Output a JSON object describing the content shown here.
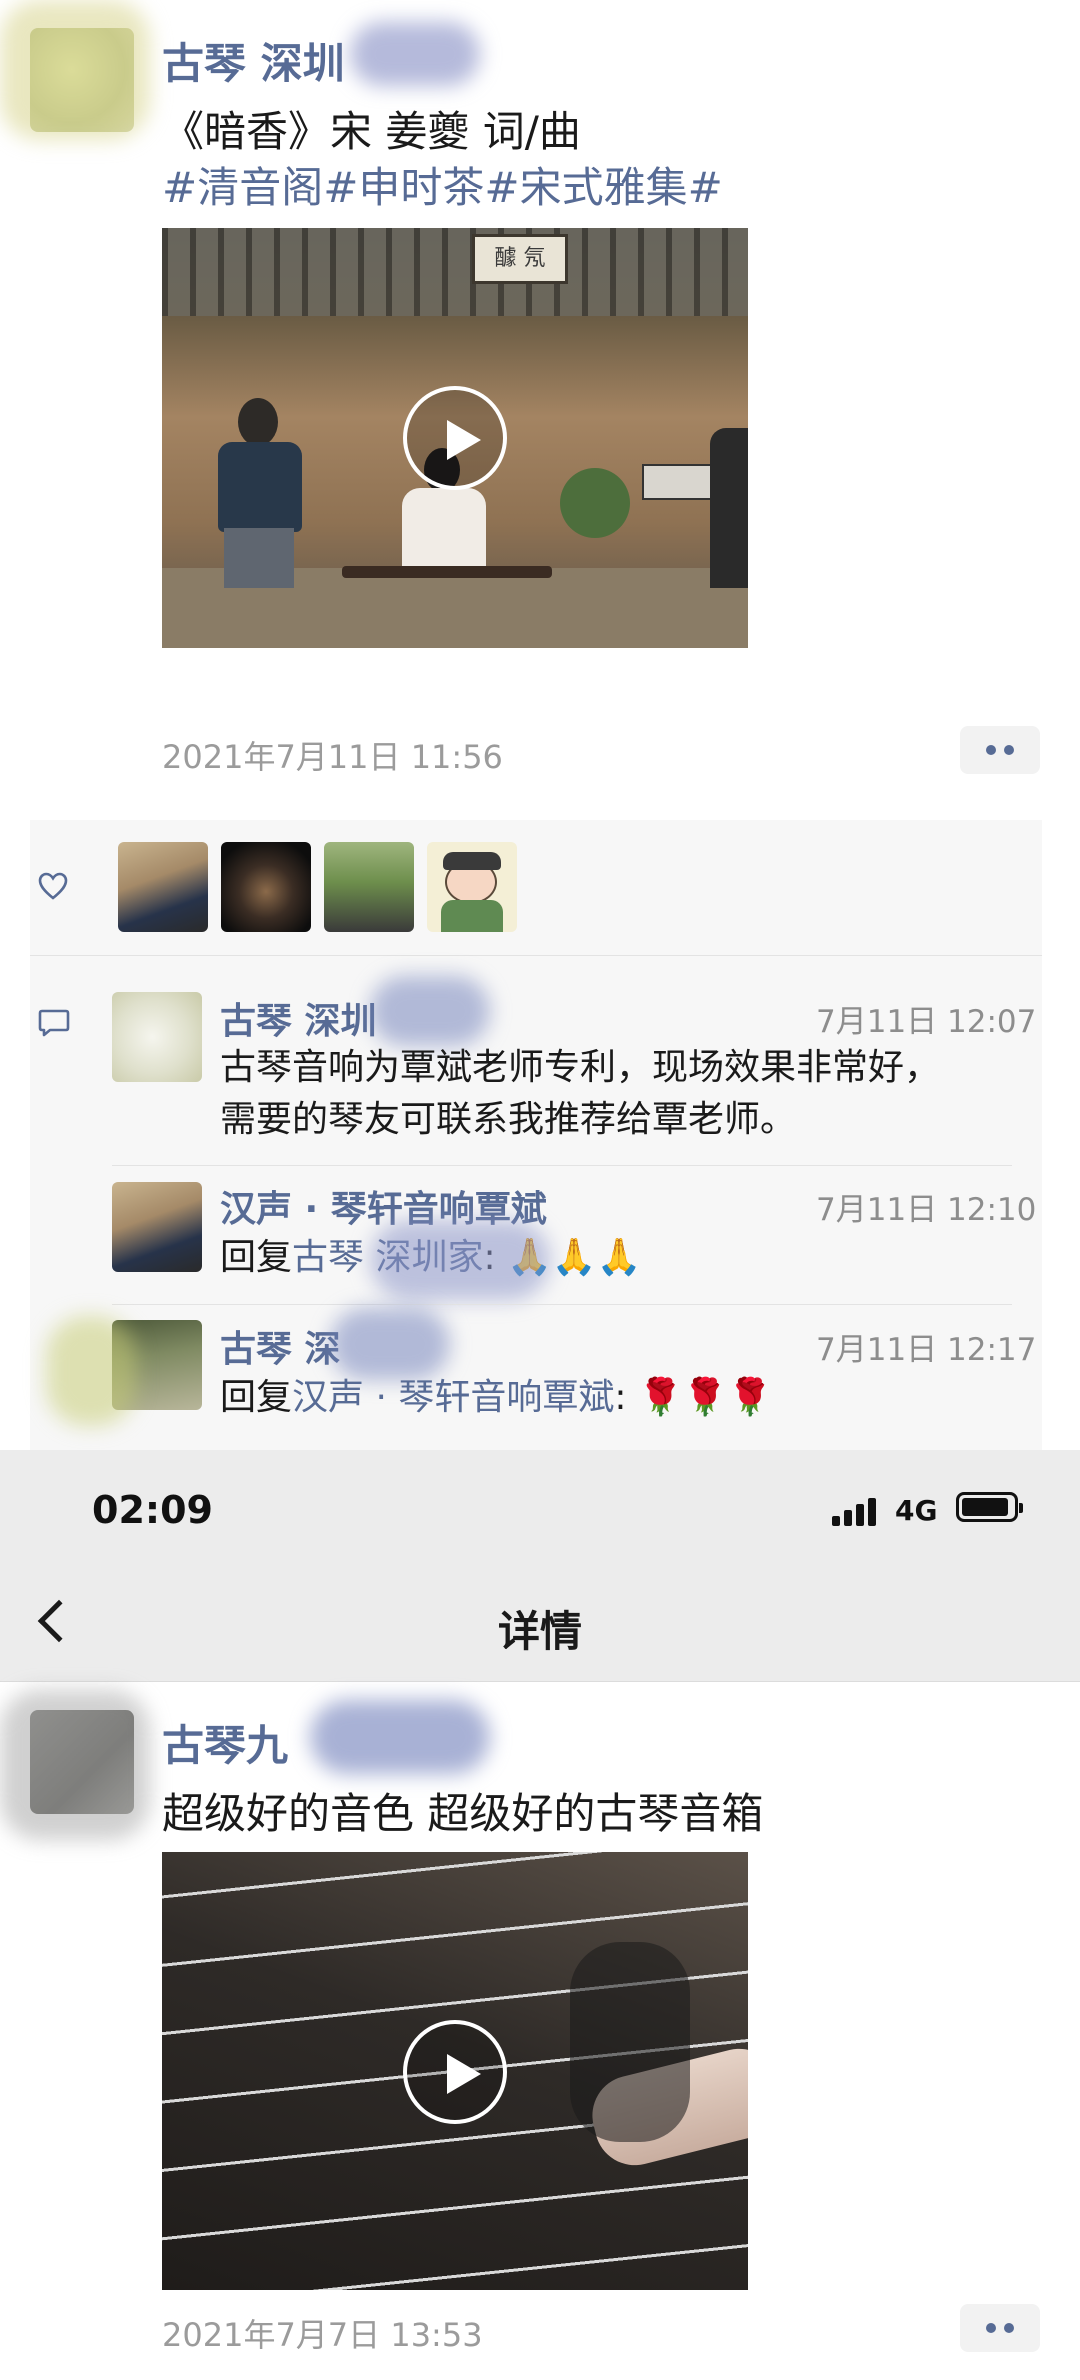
{
  "post1": {
    "author": "古琴 深圳",
    "title": "《暗香》宋 姜夔 词/曲",
    "tags": "#清音阁#申时茶#宋式雅集#",
    "plaque_text": "醵 氖",
    "time": "2021年7月11日 11:56"
  },
  "likes": {
    "icon": "heart-outline-icon"
  },
  "comments": [
    {
      "author": "古琴 深圳",
      "time": "7月11日 12:07",
      "line1": "古琴音响为覃斌老师专利，现场效果非常好，",
      "line2": "需要的琴友可联系我推荐给覃老师。"
    },
    {
      "author": "汉声 · 琴轩音响覃斌",
      "time": "7月11日 12:10",
      "reply_prefix": "回复",
      "reply_to": "古琴 深圳",
      "reply_to_tail": "家",
      "reply_sep": ": ",
      "emoji": "🙏🙏🙏"
    },
    {
      "author": "古琴 深",
      "time": "7月11日 12:17",
      "reply_prefix": "回复",
      "reply_to": "汉声 · 琴轩音响覃斌",
      "reply_sep": ": ",
      "emoji": "🌹🌹🌹"
    }
  ],
  "status_bar": {
    "time": "02:09",
    "network": "4G"
  },
  "nav": {
    "title": "详情"
  },
  "post2": {
    "author": "古琴九",
    "text": "超级好的音色 超级好的古琴音箱",
    "time": "2021年7月7日 13:53"
  },
  "colors": {
    "link": "#576b95",
    "bar_bg": "#ececec",
    "panel_bg": "#f7f7f7"
  }
}
